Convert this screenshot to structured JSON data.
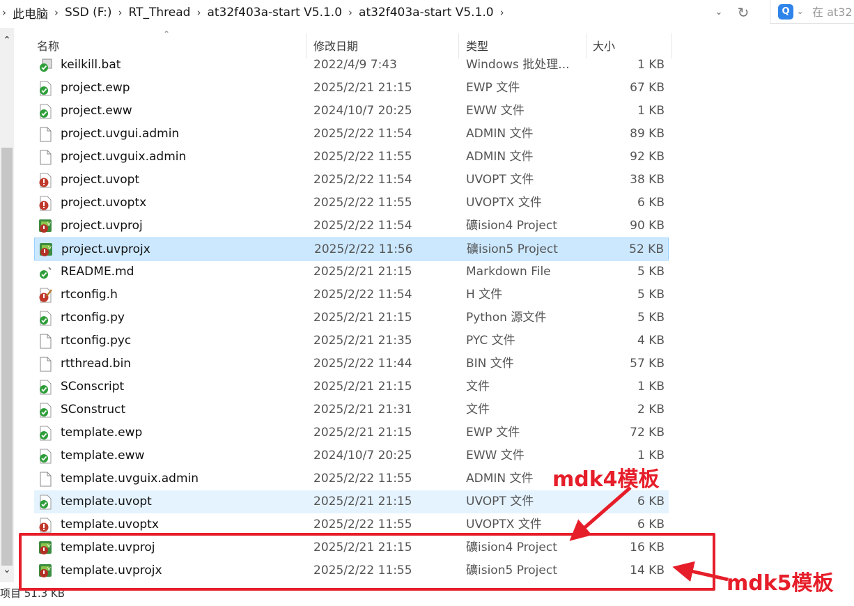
{
  "breadcrumb": {
    "items": [
      "此电脑",
      "SSD (F:)",
      "RT_Thread",
      "at32f403a-start V5.1.0",
      "at32f403a-start V5.1.0"
    ]
  },
  "search": {
    "placeholder": "在 at32"
  },
  "columns": {
    "name": "名称",
    "date": "修改日期",
    "type": "类型",
    "size": "大小"
  },
  "files": [
    {
      "name": "keilkill.bat",
      "date": "2022/4/9 7:43",
      "type": "Windows 批处理...",
      "size": "1 KB",
      "icon": "bat-icon"
    },
    {
      "name": "project.ewp",
      "date": "2025/2/21 21:15",
      "type": "EWP 文件",
      "size": "67 KB",
      "icon": "green-check-file-icon"
    },
    {
      "name": "project.eww",
      "date": "2024/10/7 20:25",
      "type": "EWW 文件",
      "size": "1 KB",
      "icon": "green-check-file-icon"
    },
    {
      "name": "project.uvgui.admin",
      "date": "2025/2/22 11:54",
      "type": "ADMIN 文件",
      "size": "89 KB",
      "icon": "blank-file-icon"
    },
    {
      "name": "project.uvguix.admin",
      "date": "2025/2/22 11:55",
      "type": "ADMIN 文件",
      "size": "92 KB",
      "icon": "blank-file-icon"
    },
    {
      "name": "project.uvopt",
      "date": "2025/2/22 11:54",
      "type": "UVOPT 文件",
      "size": "38 KB",
      "icon": "red-file-icon"
    },
    {
      "name": "project.uvoptx",
      "date": "2025/2/22 11:55",
      "type": "UVOPTX 文件",
      "size": "6 KB",
      "icon": "red-file-icon"
    },
    {
      "name": "project.uvproj",
      "date": "2025/2/22 11:54",
      "type": "礦ision4 Project",
      "size": "90 KB",
      "icon": "keil-project-icon"
    },
    {
      "name": "project.uvprojx",
      "date": "2025/2/22 11:56",
      "type": "礦ision5 Project",
      "size": "52 KB",
      "icon": "keil-project-icon",
      "state": "selected"
    },
    {
      "name": "README.md",
      "date": "2025/2/21 21:15",
      "type": "Markdown File",
      "size": "5 KB",
      "icon": "markdown-icon"
    },
    {
      "name": "rtconfig.h",
      "date": "2025/2/22 11:54",
      "type": "H 文件",
      "size": "5 KB",
      "icon": "header-file-icon"
    },
    {
      "name": "rtconfig.py",
      "date": "2025/2/21 21:15",
      "type": "Python 源文件",
      "size": "5 KB",
      "icon": "green-check-file-icon"
    },
    {
      "name": "rtconfig.pyc",
      "date": "2025/2/21 21:35",
      "type": "PYC 文件",
      "size": "4 KB",
      "icon": "blank-file-icon"
    },
    {
      "name": "rtthread.bin",
      "date": "2025/2/22 11:44",
      "type": "BIN 文件",
      "size": "57 KB",
      "icon": "blank-file-icon"
    },
    {
      "name": "SConscript",
      "date": "2025/2/21 21:15",
      "type": "文件",
      "size": "1 KB",
      "icon": "green-check-file-icon"
    },
    {
      "name": "SConstruct",
      "date": "2025/2/21 21:31",
      "type": "文件",
      "size": "2 KB",
      "icon": "green-check-file-icon"
    },
    {
      "name": "template.ewp",
      "date": "2025/2/21 21:15",
      "type": "EWP 文件",
      "size": "72 KB",
      "icon": "green-check-file-icon"
    },
    {
      "name": "template.eww",
      "date": "2024/10/7 20:25",
      "type": "EWW 文件",
      "size": "1 KB",
      "icon": "green-check-file-icon"
    },
    {
      "name": "template.uvguix.admin",
      "date": "2025/2/22 11:55",
      "type": "ADMIN 文件",
      "size": "",
      "icon": "blank-file-icon"
    },
    {
      "name": "template.uvopt",
      "date": "2025/2/21 21:15",
      "type": "UVOPT 文件",
      "size": "6 KB",
      "icon": "green-check-file-icon",
      "state": "hover"
    },
    {
      "name": "template.uvoptx",
      "date": "2025/2/22 11:55",
      "type": "UVOPTX 文件",
      "size": "6 KB",
      "icon": "red-file-icon"
    },
    {
      "name": "template.uvproj",
      "date": "2025/2/21 21:15",
      "type": "礦ision4 Project",
      "size": "16 KB",
      "icon": "keil-project-icon"
    },
    {
      "name": "template.uvprojx",
      "date": "2025/2/22 11:55",
      "type": "礦ision5 Project",
      "size": "14 KB",
      "icon": "keil-project-icon"
    }
  ],
  "status": {
    "text": "项目  51.3 KB"
  },
  "annotations": {
    "mdk4": "mdk4模板",
    "mdk5": "mdk5模板",
    "color": "#e61e2a"
  },
  "colors": {
    "selected_bg": "#cce8ff",
    "hover_bg": "#e5f3ff",
    "accent": "#2f84ea"
  }
}
